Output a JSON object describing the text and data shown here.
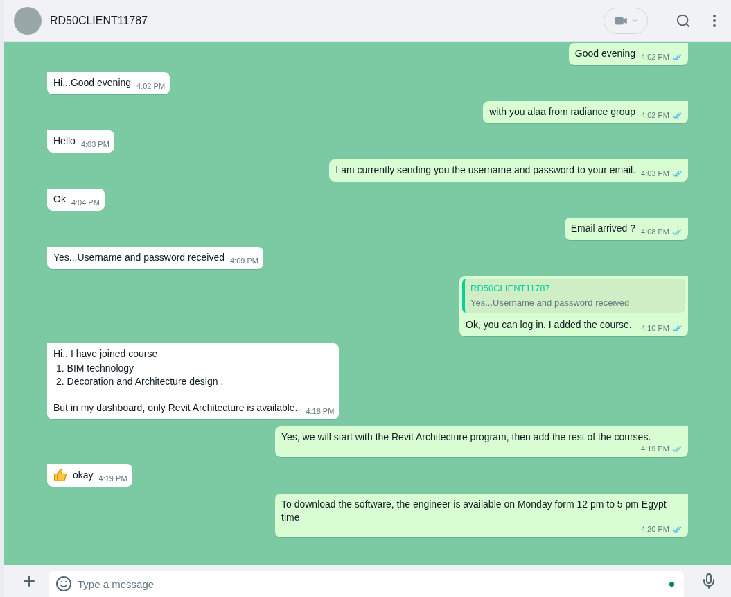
{
  "header": {
    "contact_name": "RD50CLIENT11787"
  },
  "messages": [
    {
      "kind": "outgoing",
      "text": "Good evening",
      "time": "4:02 PM",
      "read": true
    },
    {
      "kind": "incoming",
      "text": "Hi...Good evening",
      "time": "4:02 PM"
    },
    {
      "kind": "outgoing",
      "text": "with you alaa from radiance group",
      "time": "4:02 PM",
      "read": true
    },
    {
      "kind": "incoming",
      "text": "Hello",
      "time": "4:03 PM"
    },
    {
      "kind": "outgoing",
      "text": "I am currently sending you the username and password to your email.",
      "time": "4:03 PM",
      "read": true
    },
    {
      "kind": "incoming",
      "text": "Ok",
      "time": "4:04 PM"
    },
    {
      "kind": "outgoing",
      "text": "Email arrived ?",
      "time": "4:08 PM",
      "read": true
    },
    {
      "kind": "incoming",
      "text": "Yes...Username and password received",
      "time": "4:09 PM"
    },
    {
      "kind": "outgoing",
      "quote": {
        "author": "RD50CLIENT11787",
        "text": "Yes...Username and password received"
      },
      "text": "Ok, you can log in. I added the course.",
      "time": "4:10 PM",
      "read": true
    },
    {
      "kind": "incoming",
      "blocks": [
        {
          "kind": "paragraph",
          "text": "Hi.. I have joined course"
        },
        {
          "kind": "numbered_list",
          "items": [
            {
              "marker": "1.",
              "text": "BIM technology"
            },
            {
              "marker": "2.",
              "text": "Decoration and Architecture design ."
            }
          ]
        },
        {
          "kind": "paragraph",
          "text": "But in my dashboard, only Revit Architecture is available.."
        }
      ],
      "time": "4:18 PM"
    },
    {
      "kind": "outgoing",
      "text": "Yes, we will start with the Revit Architecture program, then add the rest of the courses.",
      "time": "4:19 PM",
      "read": true
    },
    {
      "kind": "incoming",
      "thumbs_up": true,
      "text": "okay",
      "time": "4:19 PM"
    },
    {
      "kind": "outgoing",
      "text": "To download the software, the engineer is available on Monday form 12 pm to 5 pm Egypt time",
      "time": "4:20 PM",
      "read": true
    }
  ],
  "composer": {
    "placeholder": "Type a message"
  }
}
